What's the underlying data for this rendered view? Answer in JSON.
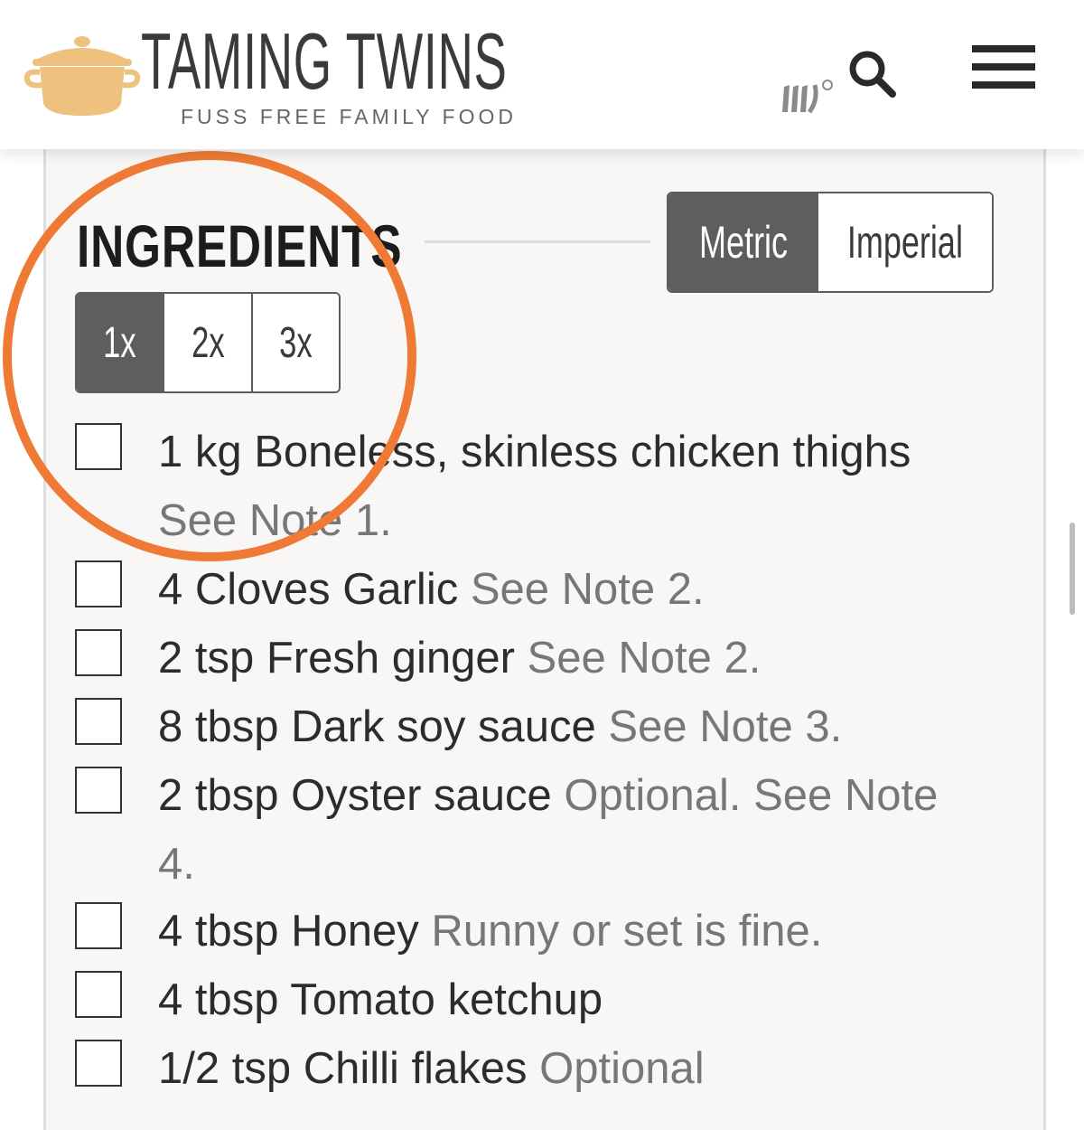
{
  "header": {
    "site_title": "TAMING TWINS",
    "tagline": "FUSS FREE FAMILY FOOD",
    "icons": [
      "pot-logo-icon",
      "mediavine-icon",
      "search-icon",
      "hamburger-menu-icon"
    ]
  },
  "recipe": {
    "heading": "INGREDIENTS",
    "unit_toggle": [
      {
        "label": "Metric",
        "active": true
      },
      {
        "label": "Imperial",
        "active": false
      }
    ],
    "scale_toggle": [
      {
        "label": "1x",
        "active": true
      },
      {
        "label": "2x",
        "active": false
      },
      {
        "label": "3x",
        "active": false
      }
    ],
    "ingredients": [
      {
        "text": "1 kg Boneless, skinless chicken thighs",
        "note": "See Note 1."
      },
      {
        "text": "4 Cloves Garlic",
        "note": "See Note 2."
      },
      {
        "text": "2 tsp Fresh ginger",
        "note": "See Note 2."
      },
      {
        "text": "8 tbsp Dark soy sauce",
        "note": "See Note 3."
      },
      {
        "text": "2 tbsp Oyster sauce",
        "note": "Optional. See Note 4."
      },
      {
        "text": "4 tbsp Honey",
        "note": "Runny or set is fine."
      },
      {
        "text": "4 tbsp Tomato ketchup",
        "note": ""
      },
      {
        "text": "1/2 tsp Chilli flakes",
        "note": "Optional"
      }
    ]
  },
  "colors": {
    "accent_circle": "#ee7a35",
    "active_button": "#5e5e5e",
    "logo_pot": "#eec17f",
    "note_text": "#777777"
  }
}
